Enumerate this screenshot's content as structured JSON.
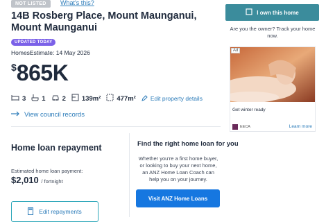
{
  "listing": {
    "status": "NOT LISTED",
    "whats_this": "What's this?",
    "address": "14B Rosberg Place, Mount Maunganui, Mount Maunganui",
    "updated_badge": "UPDATED TODAY",
    "estimate_label": "HomesEstimate: 14 May 2026",
    "price_currency": "$",
    "price_value": "865K",
    "features": {
      "bedrooms": "3",
      "bathrooms": "1",
      "car_spaces": "2",
      "floor_area": "139m²",
      "land_area": "477m²",
      "edit_label": "Edit property details"
    },
    "council_link": "View council records"
  },
  "loan": {
    "title": "Home loan repayment",
    "estimate_label": "Estimated home loan payment:",
    "amount": "$2,010",
    "frequency": "/ fortnight",
    "edit_button": "Edit repayments"
  },
  "promo": {
    "title": "Find the right home loan for you",
    "body": "Whether you're a first home buyer, or looking to buy your next home, an ANZ Home Loan Coach can help you on your journey.",
    "button": "Visit ANZ Home Loans"
  },
  "sidebar": {
    "own_button": "I own this home",
    "owner_text": "Are you the owner? Track your home now."
  },
  "ad": {
    "label": "Ad",
    "headline": "Get winter ready",
    "brand": "EECA",
    "cta": "Learn more"
  },
  "colors": {
    "link": "#2b7bb9",
    "primary_button": "#1677e0",
    "own_button": "#3b8c9c",
    "badge": "#7b61e8"
  }
}
